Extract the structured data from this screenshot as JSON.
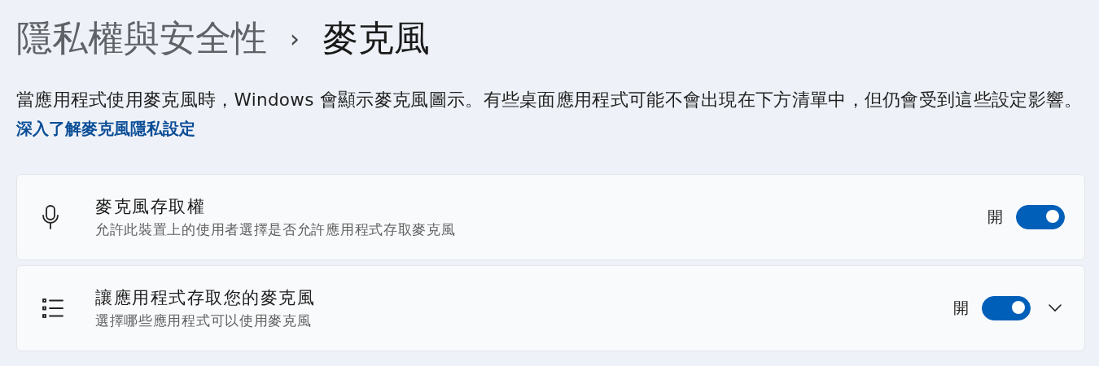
{
  "breadcrumb": {
    "parent": "隱私權與安全性",
    "separator": "›",
    "current": "麥克風"
  },
  "description": "當應用程式使用麥克風時，Windows 會顯示麥克風圖示。有些桌面應用程式可能不會出現在下方清單中，但仍會受到這些設定影響。",
  "link": "深入了解麥克風隱私設定",
  "settings": [
    {
      "kind": "microphone",
      "title": "麥克風存取權",
      "subtitle": "允許此裝置上的使用者選擇是否允許應用程式存取麥克風",
      "state_label": "開",
      "on": true
    },
    {
      "kind": "list",
      "title": "讓應用程式存取您的麥克風",
      "subtitle": "選擇哪些應用程式可以使用麥克風",
      "state_label": "開",
      "on": true,
      "expanded": false
    }
  ]
}
